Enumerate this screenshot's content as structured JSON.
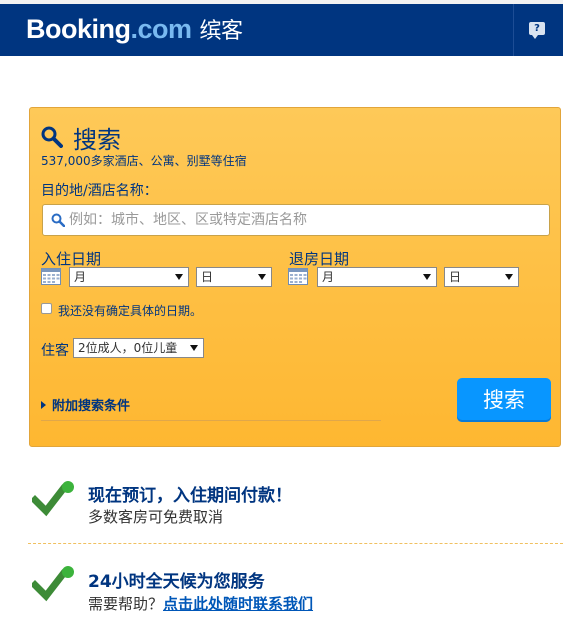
{
  "header": {
    "brand": "Booking",
    "brand_tld": ".com",
    "brand_cn": "缤客",
    "help_icon": "?"
  },
  "search": {
    "title": "搜索",
    "subtitle": "537,000多家酒店、公寓、别墅等住宿",
    "destination_label": "目的地/酒店名称：",
    "destination_placeholder": "例如：城市、地区、区或特定酒店名称",
    "destination_value": "",
    "checkin": {
      "label": "入住日期",
      "month": "月",
      "day": "日"
    },
    "checkout": {
      "label": "退房日期",
      "month": "月",
      "day": "日"
    },
    "no_dates_label": "我还没有确定具体的日期。",
    "no_dates_checked": false,
    "guests_label": "住客",
    "guests_value": "2位成人，0位儿童",
    "extra_link": "附加搜索条件",
    "search_button": "搜索"
  },
  "features": [
    {
      "title": "现在预订，入住期间付款！",
      "text": "多数客房可免费取消"
    },
    {
      "title": "24小时全天候为您服务",
      "text": "需要帮助？",
      "link": "点击此处随时联系我们"
    }
  ],
  "colors": {
    "header_bg": "#003580",
    "search_bg": "#feba35",
    "button_bg": "#0896ff",
    "check_green": "#3d8b37",
    "check_dot": "#3cb33c"
  }
}
